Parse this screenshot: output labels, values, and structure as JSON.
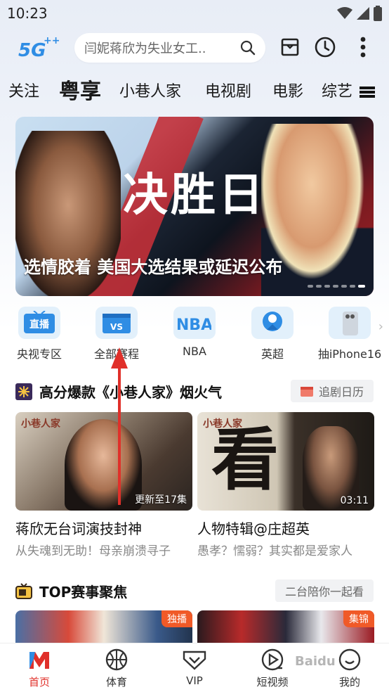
{
  "status": {
    "time": "10:23"
  },
  "search": {
    "query": "闫妮蒋欣为失业女工.."
  },
  "tabs": [
    "关注",
    "粤享",
    "小巷人家",
    "电视剧",
    "电影",
    "综艺"
  ],
  "banner": {
    "title": "决胜日",
    "caption": "选情胶着 美国大选结果或延迟公布"
  },
  "quick": [
    {
      "label": "央视专区",
      "icon_text": "直播"
    },
    {
      "label": "全部赛程",
      "icon_text": "VS"
    },
    {
      "label": "NBA",
      "icon_text": "NBA"
    },
    {
      "label": "英超",
      "icon_text": ""
    },
    {
      "label": "抽iPhone16",
      "icon_text": ""
    }
  ],
  "section1": {
    "title": "高分爆款《小巷人家》烟火气",
    "pill": "追剧日历",
    "cards": [
      {
        "stamp": "小巷人家",
        "badge": "更新至17集",
        "title": "蒋欣无台词演技封神",
        "subtitle": "从失魂到无助！母亲崩溃寻子"
      },
      {
        "stamp": "小巷人家",
        "badge": "03:11",
        "title": "人物特辑@庄超英",
        "subtitle": "愚孝？懦弱？其实都是爱家人"
      }
    ]
  },
  "section2": {
    "title": "TOP赛事聚焦",
    "pill": "二台陪你一起看",
    "tags": [
      "独播",
      "集锦"
    ]
  },
  "bottom_nav": [
    {
      "label": "首页"
    },
    {
      "label": "体育"
    },
    {
      "label": "VIP"
    },
    {
      "label": "短视频"
    },
    {
      "label": "我的"
    }
  ],
  "logo": {
    "text": "5G"
  },
  "watermark": "Baidu",
  "colors": {
    "accent": "#e0302a",
    "brand_blue": "#2f8de4",
    "badge_orange": "#f05a28"
  }
}
